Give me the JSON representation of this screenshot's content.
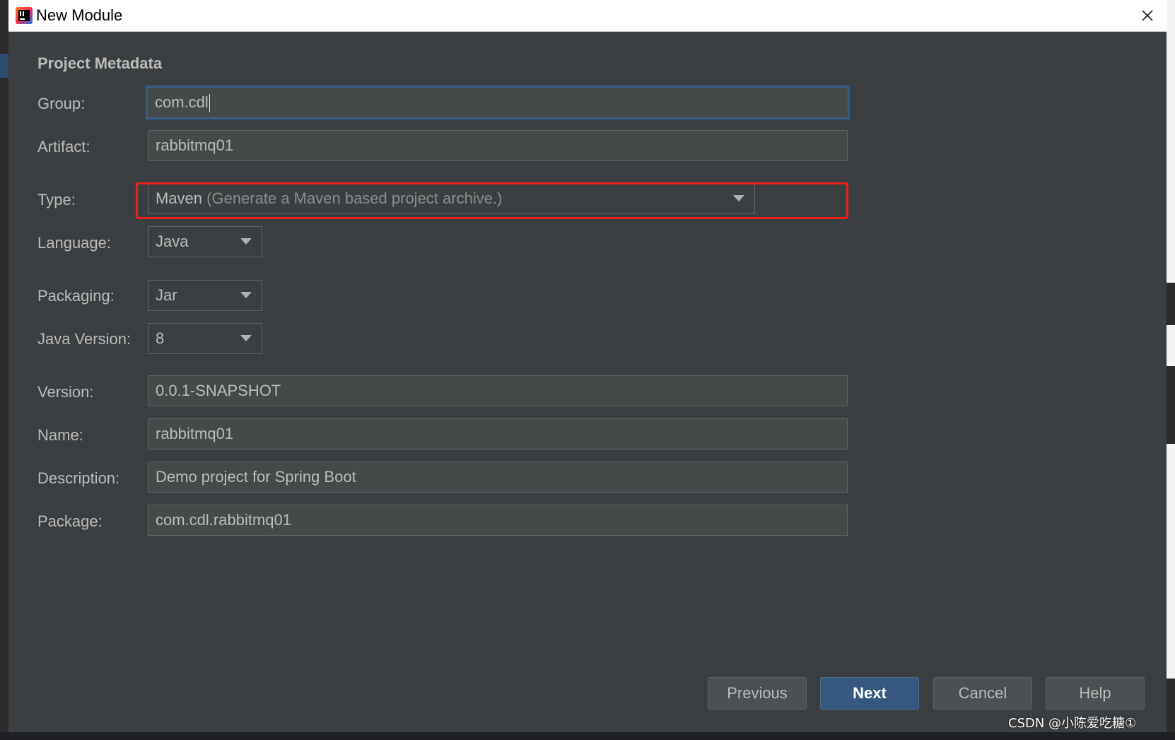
{
  "window": {
    "title": "New Module"
  },
  "section": {
    "title": "Project Metadata"
  },
  "form": {
    "group": {
      "label": "Group:",
      "value": "com.cdl"
    },
    "artifact": {
      "label": "Artifact:",
      "value": "rabbitmq01"
    },
    "type": {
      "label": "Type:",
      "value": "Maven",
      "hint": "(Generate a Maven based project archive.)"
    },
    "language": {
      "label": "Language:",
      "value": "Java"
    },
    "packaging": {
      "label": "Packaging:",
      "value": "Jar"
    },
    "java_version": {
      "label": "Java Version:",
      "value": "8"
    },
    "version": {
      "label": "Version:",
      "value": "0.0.1-SNAPSHOT"
    },
    "name": {
      "label": "Name:",
      "value": "rabbitmq01"
    },
    "description": {
      "label": "Description:",
      "value": "Demo project for Spring Boot"
    },
    "package": {
      "label": "Package:",
      "value": "com.cdl.rabbitmq01"
    }
  },
  "buttons": {
    "previous": "Previous",
    "next": "Next",
    "cancel": "Cancel",
    "help": "Help"
  },
  "watermark": "CSDN @小陈爱吃糖①",
  "colors": {
    "dialog_bg": "#3c3f41",
    "field_bg": "#45494a",
    "text": "#bbbbbb",
    "primary_button": "#365880",
    "focus_border": "#3d6185",
    "highlight_box": "#e8211a"
  },
  "icons": [
    "intellij-app-icon",
    "close-icon",
    "chevron-down-icon"
  ]
}
